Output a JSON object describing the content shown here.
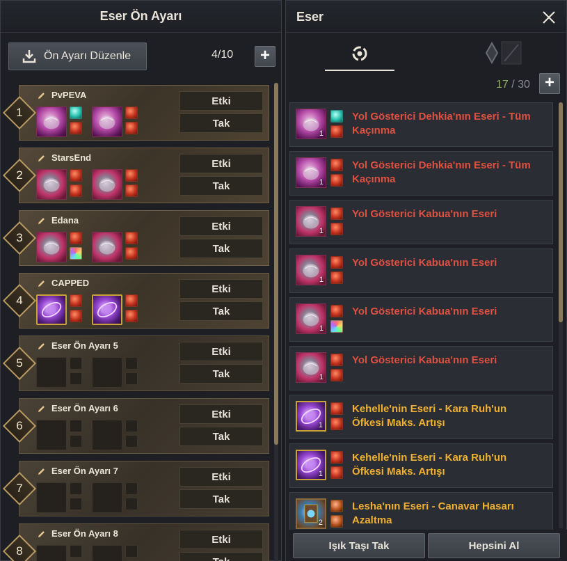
{
  "left_panel": {
    "title": "Eser Ön Ayarı",
    "edit_button_label": "Ön Ayarı Düzenle",
    "count": "4/10",
    "add_label": "+",
    "presets": [
      {
        "number": "1",
        "name": "PvPEVA",
        "etki": "Etki",
        "tak": "Tak",
        "art": [
          "pink",
          "pink"
        ],
        "gems": [
          [
            "cyan",
            "red"
          ],
          [
            "red",
            "red"
          ]
        ]
      },
      {
        "number": "2",
        "name": "StarsEnd",
        "etki": "Etki",
        "tak": "Tak",
        "art": [
          "mag",
          "mag"
        ],
        "gems": [
          [
            "red",
            "red"
          ],
          [
            "red",
            "red"
          ]
        ]
      },
      {
        "number": "3",
        "name": "Edana",
        "etki": "Etki",
        "tak": "Tak",
        "art": [
          "mag",
          "mag"
        ],
        "gems": [
          [
            "red",
            "rainbow"
          ],
          [
            "red",
            "red"
          ]
        ]
      },
      {
        "number": "4",
        "name": "CAPPED",
        "etki": "Etki",
        "tak": "Tak",
        "art": [
          "purple",
          "purple"
        ],
        "gems": [
          [
            "red",
            "red"
          ],
          [
            "red",
            "red"
          ]
        ]
      },
      {
        "number": "5",
        "name": "Eser Ön Ayarı 5",
        "etki": "Etki",
        "tak": "Tak",
        "art": [
          "",
          ""
        ],
        "gems": [
          [
            "",
            ""
          ],
          [
            "",
            ""
          ]
        ]
      },
      {
        "number": "6",
        "name": "Eser Ön Ayarı 6",
        "etki": "Etki",
        "tak": "Tak",
        "art": [
          "",
          ""
        ],
        "gems": [
          [
            "",
            ""
          ],
          [
            "",
            ""
          ]
        ]
      },
      {
        "number": "7",
        "name": "Eser Ön Ayarı 7",
        "etki": "Etki",
        "tak": "Tak",
        "art": [
          "",
          ""
        ],
        "gems": [
          [
            "",
            ""
          ],
          [
            "",
            ""
          ]
        ]
      },
      {
        "number": "8",
        "name": "Eser Ön Ayarı 8",
        "etki": "Etki",
        "tak": "Tak",
        "art": [
          "",
          ""
        ],
        "gems": [
          [
            "",
            ""
          ],
          [
            "",
            ""
          ]
        ]
      }
    ]
  },
  "right_panel": {
    "title": "Eser",
    "count_current": "17",
    "count_sep": " / ",
    "count_max": "30",
    "add_label": "+",
    "items": [
      {
        "name": "Yol Gösterici Dehkia'nın Eseri - Tüm Kaçınma",
        "color": "red",
        "art": "pink",
        "qty": "1",
        "gems": [
          "cyan",
          "red"
        ]
      },
      {
        "name": "Yol Gösterici Dehkia'nın Eseri - Tüm Kaçınma",
        "color": "red",
        "art": "pink",
        "qty": "1",
        "gems": [
          "red",
          "red"
        ]
      },
      {
        "name": "Yol Gösterici Kabua'nın Eseri",
        "color": "red",
        "art": "mag",
        "qty": "1",
        "gems": [
          "red",
          "red"
        ]
      },
      {
        "name": "Yol Gösterici Kabua'nın Eseri",
        "color": "red",
        "art": "mag",
        "qty": "1",
        "gems": [
          "red",
          "red"
        ]
      },
      {
        "name": "Yol Gösterici Kabua'nın Eseri",
        "color": "red",
        "art": "mag",
        "qty": "1",
        "gems": [
          "red",
          "rainbow"
        ]
      },
      {
        "name": "Yol Gösterici Kabua'nın Eseri",
        "color": "red",
        "art": "mag",
        "qty": "1",
        "gems": [
          "red",
          "red"
        ]
      },
      {
        "name": "Kehelle'nin Eseri - Kara Ruh'un Öfkesi Maks. Artışı",
        "color": "gold",
        "art": "purple",
        "qty": "1",
        "gems": [
          "red",
          "red"
        ]
      },
      {
        "name": "Kehelle'nin Eseri - Kara Ruh'un Öfkesi Maks. Artışı",
        "color": "gold",
        "art": "purple",
        "qty": "1",
        "gems": [
          "red",
          "red"
        ]
      },
      {
        "name": "Lesha'nın Eseri - Canavar Hasarı Azaltma",
        "color": "gold",
        "art": "blue",
        "qty": "2",
        "gems": [
          "dark",
          "dark"
        ]
      }
    ],
    "footer": {
      "light_stone_button": "Işık Taşı Tak",
      "take_all_button": "Hepsini Al"
    }
  },
  "colors": {
    "accent_gold": "#b89a62",
    "name_red": "#e05040",
    "name_gold": "#f0b030",
    "count_green": "#8fb35c"
  }
}
